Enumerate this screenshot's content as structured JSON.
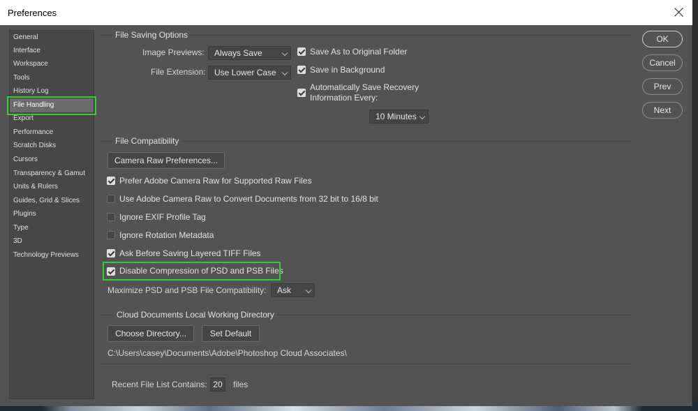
{
  "window": {
    "title": "Preferences"
  },
  "sidebar": {
    "items": [
      {
        "label": "General"
      },
      {
        "label": "Interface"
      },
      {
        "label": "Workspace"
      },
      {
        "label": "Tools"
      },
      {
        "label": "History Log"
      },
      {
        "label": "File Handling",
        "selected": true
      },
      {
        "label": "Export"
      },
      {
        "label": "Performance"
      },
      {
        "label": "Scratch Disks"
      },
      {
        "label": "Cursors"
      },
      {
        "label": "Transparency & Gamut"
      },
      {
        "label": "Units & Rulers"
      },
      {
        "label": "Guides, Grid & Slices"
      },
      {
        "label": "Plugins"
      },
      {
        "label": "Type"
      },
      {
        "label": "3D"
      },
      {
        "label": "Technology Previews"
      }
    ]
  },
  "file_saving": {
    "title": "File Saving Options",
    "image_previews_label": "Image Previews:",
    "image_previews_value": "Always Save",
    "file_extension_label": "File Extension:",
    "file_extension_value": "Use Lower Case",
    "save_as_original": {
      "label": "Save As to Original Folder",
      "checked": true
    },
    "save_in_background": {
      "label": "Save in Background",
      "checked": true
    },
    "auto_save_recovery": {
      "label_line1": "Automatically Save Recovery",
      "label_line2": "Information Every:",
      "checked": true
    },
    "interval_value": "10 Minutes"
  },
  "file_compat": {
    "title": "File Compatibility",
    "camera_raw_button": "Camera Raw Preferences...",
    "options": [
      {
        "label": "Prefer Adobe Camera Raw for Supported Raw Files",
        "checked": true
      },
      {
        "label": "Use Adobe Camera Raw to Convert Documents from 32 bit to 16/8 bit",
        "checked": false
      },
      {
        "label": "Ignore EXIF Profile Tag",
        "checked": false
      },
      {
        "label": "Ignore Rotation Metadata",
        "checked": false
      },
      {
        "label": "Ask Before Saving Layered TIFF Files",
        "checked": true
      },
      {
        "label": "Disable Compression of PSD and PSB Files",
        "checked": true
      }
    ],
    "maximize_label": "Maximize PSD and PSB File Compatibility:",
    "maximize_value": "Ask"
  },
  "cloud": {
    "title": "Cloud Documents Local Working Directory",
    "choose_button": "Choose Directory...",
    "default_button": "Set Default",
    "path": "C:\\Users\\casey\\Documents\\Adobe\\Photoshop Cloud Associates\\"
  },
  "recent": {
    "label": "Recent File List Contains:",
    "value": "20",
    "suffix": "files"
  },
  "buttons": {
    "ok": "OK",
    "cancel": "Cancel",
    "prev": "Prev",
    "next": "Next"
  },
  "colors": {
    "panel": "#535353",
    "sidebar": "#474747",
    "highlight": "#2ed12e"
  }
}
